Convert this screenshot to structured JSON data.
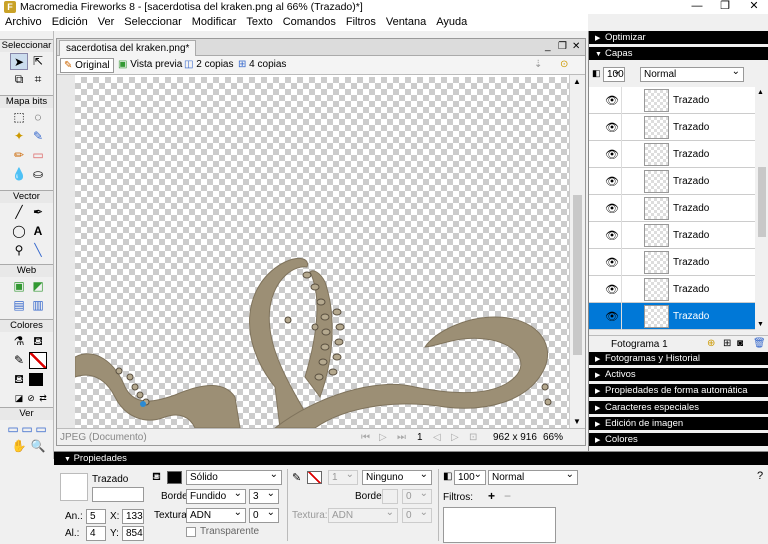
{
  "window": {
    "title": "Macromedia Fireworks 8 - [sacerdotisa del kraken.png al  66% (Trazado)*]"
  },
  "menu": [
    "Archivo",
    "Edición",
    "Ver",
    "Seleccionar",
    "Modificar",
    "Texto",
    "Comandos",
    "Filtros",
    "Ventana",
    "Ayuda"
  ],
  "tools": {
    "select_head": "Seleccionar",
    "bitmap_head": "Mapa bits",
    "vector_head": "Vector",
    "web_head": "Web",
    "colors_head": "Colores",
    "view_head": "Ver"
  },
  "document": {
    "tab_name": "sacerdotisa del kraken.png*",
    "views": {
      "original": "Original",
      "preview": "Vista previa",
      "two": "2 copias",
      "four": "4 copias"
    },
    "status_type": "JPEG (Documento)",
    "page": "1",
    "size": "962 x 916",
    "zoom": "66%"
  },
  "panels": {
    "optimize": "Optimizar",
    "layers": "Capas",
    "opacity": "100",
    "blend": "Normal",
    "layers_list": [
      "Trazado",
      "Trazado",
      "Trazado",
      "Trazado",
      "Trazado",
      "Trazado",
      "Trazado",
      "Trazado",
      "Trazado"
    ],
    "selected_layer_index": 8,
    "frame": "Fotograma 1",
    "collapsed": [
      "Fotogramas y Historial",
      "Activos",
      "Propiedades de forma automática",
      "Caracteres especiales",
      "Edición de imagen",
      "Colores"
    ]
  },
  "properties": {
    "header": "Propiedades",
    "object_type": "Trazado",
    "fill_type": "Sólido",
    "edge_label": "Borde:",
    "edge_value": "Fundido",
    "edge_amount": "3",
    "texture_label": "Textura:",
    "texture_value": "ADN",
    "texture_amount": "0",
    "transparent": "Transparente",
    "stroke_size": "1",
    "stroke_type": "Ninguno",
    "stroke_edge_label": "Borde:",
    "stroke_edge_amount": "0",
    "stroke_texture_label": "Textura:",
    "stroke_texture_value": "ADN",
    "stroke_texture_amount": "0",
    "opacity": "100",
    "blend": "Normal",
    "filters_label": "Filtros:",
    "w_label": "An.:",
    "w": "5",
    "h_label": "Al.:",
    "h": "4",
    "x_label": "X:",
    "x": "133",
    "y_label": "Y:",
    "y": "854"
  },
  "colors": {
    "tentacle": "#9c8f75",
    "tentacle_dark": "#5a5040",
    "selection": "#0078d7",
    "header": "#000000"
  }
}
